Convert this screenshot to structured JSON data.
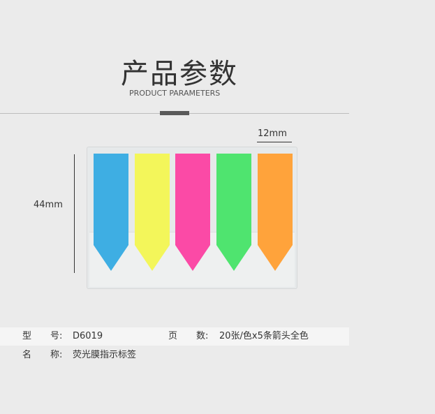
{
  "header": {
    "title_cn": "产品参数",
    "title_en": "PRODUCT PARAMETERS"
  },
  "dimensions": {
    "width_label": "12mm",
    "height_label": "44mm"
  },
  "product_image": {
    "flags": [
      {
        "name": "blue",
        "color": "#3eaee3"
      },
      {
        "name": "yellow",
        "color": "#f3f65a"
      },
      {
        "name": "pink",
        "color": "#fb4aa6"
      },
      {
        "name": "green",
        "color": "#4fe46f"
      },
      {
        "name": "orange",
        "color": "#ffa33b"
      }
    ],
    "card_color": "#e6e9ea"
  },
  "specs": {
    "model_label_1": "型",
    "model_label_2": "号:",
    "model_value": "D6019",
    "pages_label_1": "页",
    "pages_label_2": "数:",
    "pages_value": "20张/色x5条箭头全色",
    "name_label_1": "名",
    "name_label_2": "称:",
    "name_value": "荧光膜指示标签"
  }
}
